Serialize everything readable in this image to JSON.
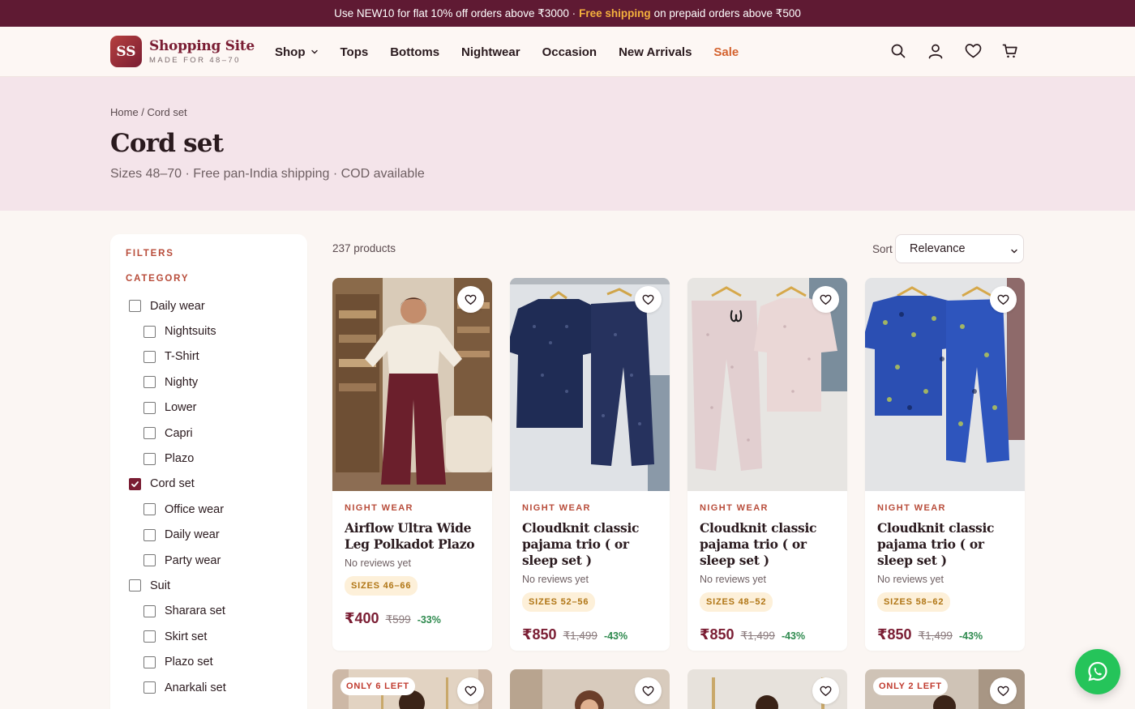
{
  "promo": {
    "text_before": "Use NEW10 for flat 10% off orders above ₹3000 ·",
    "highlight": "Free shipping",
    "text_after": "on prepaid orders above ₹500"
  },
  "brand": {
    "badge": "SS",
    "name": "Shopping Site",
    "tagline": "MADE FOR 48–70"
  },
  "nav": {
    "items": [
      {
        "label": "Shop"
      },
      {
        "label": "Tops"
      },
      {
        "label": "Bottoms"
      },
      {
        "label": "Nightwear"
      },
      {
        "label": "Occasion"
      },
      {
        "label": "New Arrivals"
      },
      {
        "label": "Sale"
      }
    ]
  },
  "header_icons": [
    "search-icon",
    "account-icon",
    "wishlist-icon",
    "cart-icon"
  ],
  "hero": {
    "breadcrumb_home": "Home",
    "breadcrumb_sep": " / ",
    "breadcrumb_current": "Cord set",
    "title": "Cord set",
    "subtitle": "Sizes 48–70 · Free pan-India shipping · COD available"
  },
  "filters": {
    "title": "FILTERS",
    "category_heading": "CATEGORY",
    "items": [
      {
        "label": "Daily wear",
        "level": 0,
        "checked": false
      },
      {
        "label": "Nightsuits",
        "level": 1,
        "checked": false
      },
      {
        "label": "T-Shirt",
        "level": 1,
        "checked": false
      },
      {
        "label": "Nighty",
        "level": 1,
        "checked": false
      },
      {
        "label": "Lower",
        "level": 1,
        "checked": false
      },
      {
        "label": "Capri",
        "level": 1,
        "checked": false
      },
      {
        "label": "Plazo",
        "level": 1,
        "checked": false
      },
      {
        "label": "Cord set",
        "level": 0,
        "checked": true
      },
      {
        "label": "Office wear",
        "level": 1,
        "checked": false
      },
      {
        "label": "Daily wear",
        "level": 1,
        "checked": false
      },
      {
        "label": "Party wear",
        "level": 1,
        "checked": false
      },
      {
        "label": "Suit",
        "level": 0,
        "checked": false
      },
      {
        "label": "Sharara set",
        "level": 1,
        "checked": false
      },
      {
        "label": "Skirt set",
        "level": 1,
        "checked": false
      },
      {
        "label": "Plazo set",
        "level": 1,
        "checked": false
      },
      {
        "label": "Anarkali set",
        "level": 1,
        "checked": false
      }
    ]
  },
  "results": {
    "count": "237 products",
    "sort_label": "Sort",
    "sort_value": "Relevance"
  },
  "products": [
    {
      "category": "NIGHT WEAR",
      "title": "Airflow Ultra Wide Leg Polkadot Plazo",
      "reviews": "No reviews yet",
      "sizes": "SIZES 46–66",
      "price": "₹400",
      "was": "₹599",
      "off": "-33%"
    },
    {
      "category": "NIGHT WEAR",
      "title": "Cloudknit classic pajama trio ( or sleep set )",
      "reviews": "No reviews yet",
      "sizes": "SIZES 52–56",
      "price": "₹850",
      "was": "₹1,499",
      "off": "-43%"
    },
    {
      "category": "NIGHT WEAR",
      "title": "Cloudknit classic pajama trio ( or sleep set )",
      "reviews": "No reviews yet",
      "sizes": "SIZES 48–52",
      "price": "₹850",
      "was": "₹1,499",
      "off": "-43%"
    },
    {
      "category": "NIGHT WEAR",
      "title": "Cloudknit classic pajama trio ( or sleep set )",
      "reviews": "No reviews yet",
      "sizes": "SIZES 58–62",
      "price": "₹850",
      "was": "₹1,499",
      "off": "-43%"
    }
  ],
  "row2": [
    {
      "stock": "ONLY 6 LEFT"
    },
    {
      "stock": ""
    },
    {
      "stock": ""
    },
    {
      "stock": "ONLY 2 LEFT"
    }
  ],
  "colors": {
    "promo_bg": "#5f1a33",
    "brand": "#7a1d33",
    "accent": "#b84c3a",
    "sale": "#d4632f",
    "discount": "#2e8a4e",
    "whatsapp": "#25c45a"
  }
}
